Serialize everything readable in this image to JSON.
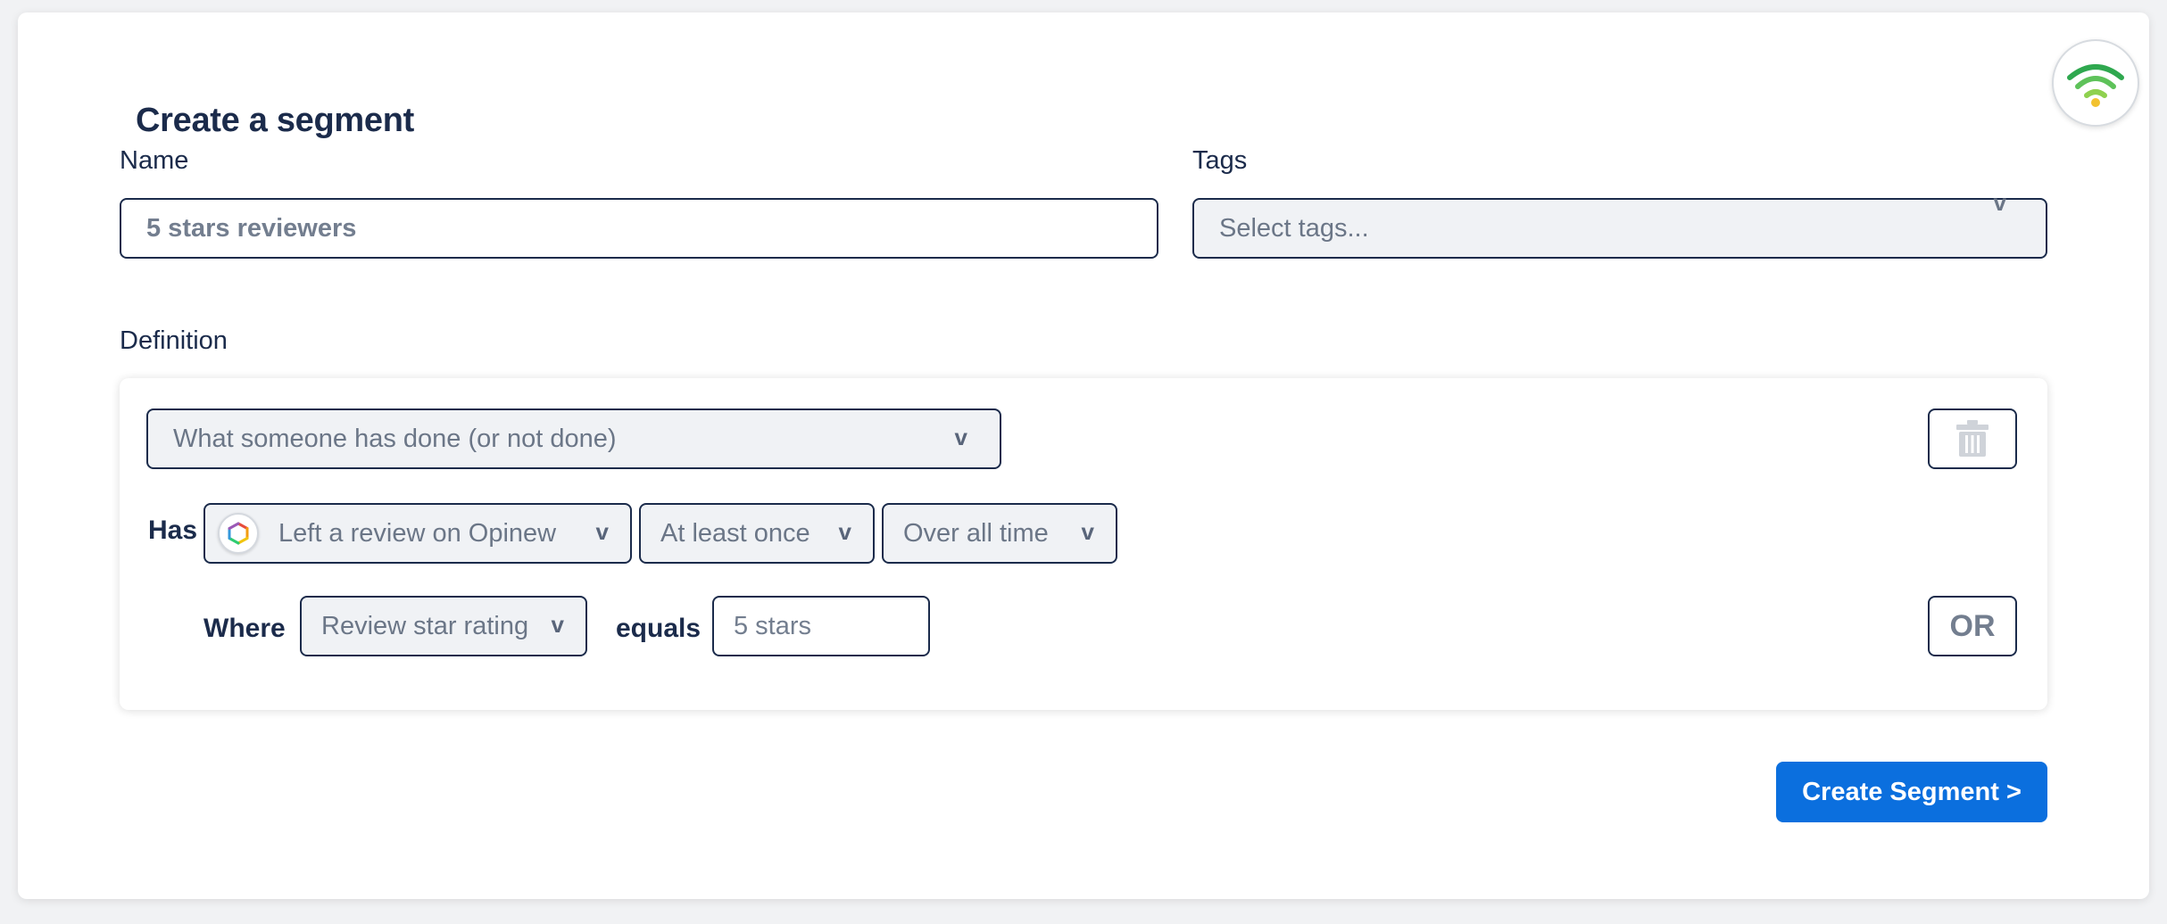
{
  "header": {
    "title": "Create a segment",
    "logo_icon": "signal-logo-icon"
  },
  "form": {
    "name_label": "Name",
    "name_value": "5 stars reviewers",
    "tags_label": "Tags",
    "tags_placeholder": "Select tags...",
    "definition_label": "Definition"
  },
  "definition": {
    "type_select": "What someone has done (or not done)",
    "has_label": "Has",
    "event_select": "Left a review on Opinew",
    "frequency_select": "At least once",
    "timeframe_select": "Over all time",
    "where_label": "Where",
    "property_select": "Review star rating",
    "equals_label": "equals",
    "value_input": "5 stars",
    "or_label": "OR"
  },
  "chevron": "v",
  "actions": {
    "create_label": "Create Segment >"
  },
  "colors": {
    "accent": "#0b6fde",
    "text_dark": "#1b2b4b",
    "muted": "#6b7687",
    "select_bg": "#f0f2f5"
  }
}
